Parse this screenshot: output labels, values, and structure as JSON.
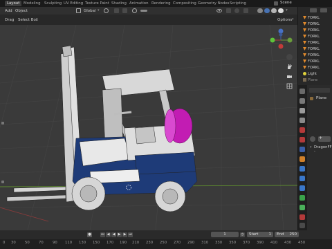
{
  "workspace_tabs": [
    "Layout",
    "Modeling",
    "Sculpting",
    "UV Editing",
    "Texture Paint",
    "Shading",
    "Animation",
    "Rendering",
    "Compositing",
    "Geometry Nodes",
    "Scripting"
  ],
  "scene_name": "Scene",
  "header": {
    "menus": [
      "Add",
      "Object"
    ],
    "transform_orientation": "Global",
    "drag_label": "Drag",
    "select_mode": "Select Box",
    "options_label": "Options"
  },
  "outliner": {
    "items": [
      "FORKL",
      "FORKL",
      "FORKL",
      "FORKL",
      "FORKL",
      "FORKL",
      "FORKL",
      "FORKL",
      "FORKL",
      "FORKL",
      "Light",
      "Plane"
    ]
  },
  "properties": {
    "object_name": "Plane",
    "modifier_name": "DragonFF -"
  },
  "timeline": {
    "current_frame": "1",
    "start_label": "Start",
    "start_value": "1",
    "end_label": "End",
    "end_value": "250",
    "ruler_ticks": [
      "0",
      "30",
      "50",
      "70",
      "90",
      "110",
      "130",
      "150",
      "170",
      "190",
      "210",
      "230",
      "250",
      "270",
      "290",
      "310",
      "330",
      "350",
      "370",
      "390",
      "410",
      "430",
      "450"
    ]
  },
  "colors": {
    "accent": "#4772b3",
    "forklift_blue": "#1e3b78",
    "tank_magenta": "#c21cb3"
  },
  "icons": [
    "scene-icon",
    "grid-gizmo",
    "hand-icon",
    "camera-icon",
    "zoom-icon",
    "play-icon"
  ]
}
